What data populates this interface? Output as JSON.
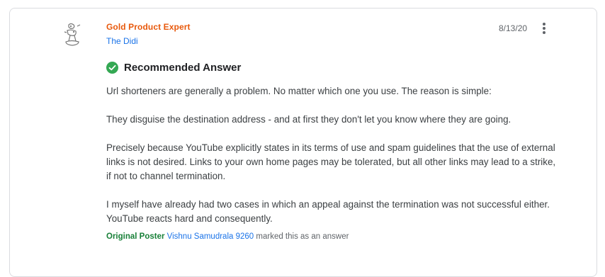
{
  "post": {
    "badge": "Gold Product Expert",
    "author": "The Didi",
    "date": "8/13/20",
    "recommended_label": "Recommended Answer",
    "paragraphs": [
      "Url shorteners are generally a problem. No matter which one you use. The reason is simple:",
      "They disguise the destination address - and at first they don't let you know where they are going.",
      "Precisely because YouTube explicitly states in its terms of use and spam guidelines that the use of external links is not desired. Links to your own home pages may be tolerated, but all other links may lead to a strike, if not to channel termination.",
      "I myself have already had two cases in which an appeal against the termination was not successful either. YouTube reacts hard and consequently."
    ],
    "footer": {
      "op_label": "Original Poster",
      "op_name": "Vishnu Samudrala 9260",
      "suffix": "marked this as an answer"
    }
  },
  "icons": {
    "more": "more-vert-icon",
    "check": "check-circle-icon",
    "avatar": "avatar-image"
  },
  "colors": {
    "badge": "#e8590c",
    "link": "#1a73e8",
    "op": "#188038",
    "check": "#34a853"
  }
}
